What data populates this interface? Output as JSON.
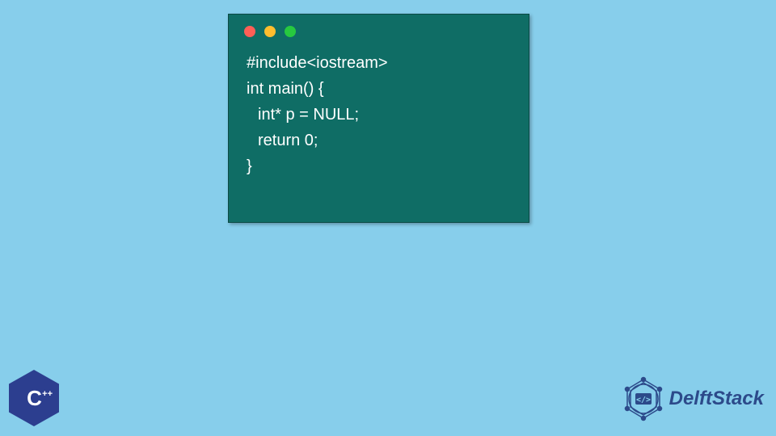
{
  "code": {
    "lines": [
      {
        "text": "#include<iostream>",
        "indent": 0
      },
      {
        "text": "int main() {",
        "indent": 0
      },
      {
        "text": "int* p = NULL;",
        "indent": 1
      },
      {
        "text": "return 0;",
        "indent": 1
      },
      {
        "text": "}",
        "indent": 0
      }
    ]
  },
  "window_controls": {
    "colors": [
      "#ff5f56",
      "#ffbd2e",
      "#27c93f"
    ]
  },
  "cpp_badge": {
    "letter": "C",
    "plus": "++"
  },
  "delft": {
    "text": "DelftStack"
  },
  "colors": {
    "background": "#87ceeb",
    "code_bg": "#0f6d65",
    "code_text": "#ffffff",
    "cpp_hex": "#2c3e8f",
    "delft_color": "#2c4a8a"
  }
}
